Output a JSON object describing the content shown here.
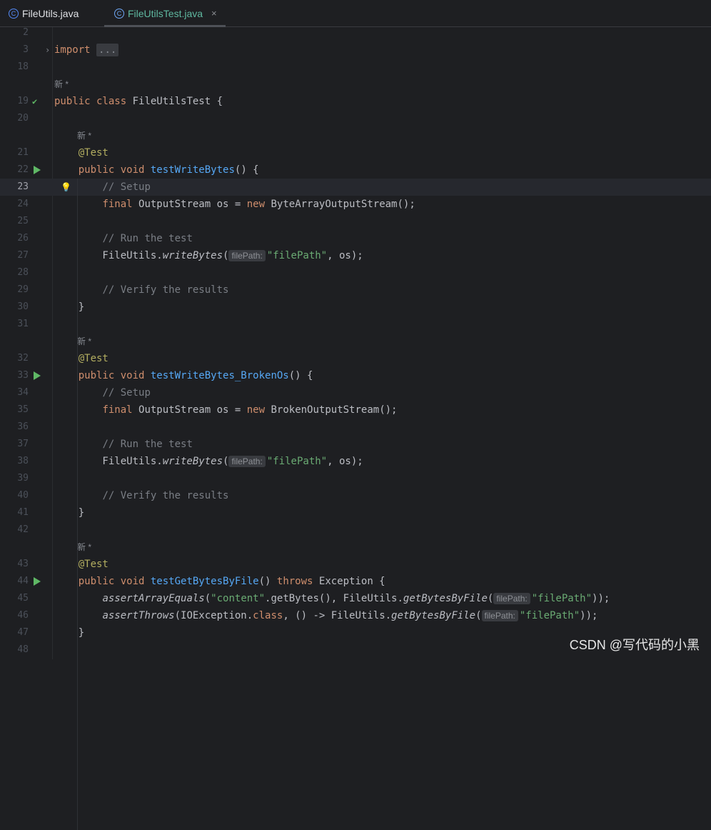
{
  "tabs": [
    {
      "label": "FileUtils.java",
      "icon": "class-icon"
    },
    {
      "label": "FileUtilsTest.java",
      "icon": "class-icon",
      "active": true,
      "close": "×"
    }
  ],
  "lines": [
    {
      "n": "2",
      "kind": "code",
      "html": ""
    },
    {
      "n": "3",
      "kind": "code",
      "fold": true,
      "html": "<span class='kw'>import</span> <span class='fold-box'>...</span>"
    },
    {
      "n": "18",
      "kind": "code",
      "html": ""
    },
    {
      "n": "",
      "kind": "hint",
      "indent": 0,
      "text": "新 *"
    },
    {
      "n": "19",
      "kind": "code",
      "icon": "check-run",
      "html": "<span class='kw'>public class</span> FileUtilsTest {"
    },
    {
      "n": "20",
      "kind": "code",
      "html": ""
    },
    {
      "n": "",
      "kind": "hint",
      "indent": 1,
      "text": "新 *"
    },
    {
      "n": "21",
      "kind": "code",
      "html": "    <span class='ann'>@Test</span>"
    },
    {
      "n": "22",
      "kind": "code",
      "icon": "run",
      "html": "    <span class='kw'>public void</span> <span class='fn'>testWriteBytes</span>() {"
    },
    {
      "n": "23",
      "kind": "code",
      "current": true,
      "bulb": true,
      "html": "        <span class='cm'>// Setup</span>"
    },
    {
      "n": "24",
      "kind": "code",
      "html": "        <span class='kw'>final</span> OutputStream os = <span class='kw'>new</span> ByteArrayOutputStream();"
    },
    {
      "n": "25",
      "kind": "code",
      "html": ""
    },
    {
      "n": "26",
      "kind": "code",
      "html": "        <span class='cm'>// Run the test</span>"
    },
    {
      "n": "27",
      "kind": "code",
      "html": "        FileUtils.<span class='it'>writeBytes</span>(<span class='inlay'>filePath:</span><span class='str'>\"filePath\"</span>, os);"
    },
    {
      "n": "28",
      "kind": "code",
      "html": ""
    },
    {
      "n": "29",
      "kind": "code",
      "html": "        <span class='cm'>// Verify the results</span>"
    },
    {
      "n": "30",
      "kind": "code",
      "html": "    }"
    },
    {
      "n": "31",
      "kind": "code",
      "html": ""
    },
    {
      "n": "",
      "kind": "hint",
      "indent": 1,
      "text": "新 *"
    },
    {
      "n": "32",
      "kind": "code",
      "html": "    <span class='ann'>@Test</span>"
    },
    {
      "n": "33",
      "kind": "code",
      "icon": "run",
      "html": "    <span class='kw'>public void</span> <span class='fn'>testWriteBytes_BrokenOs</span>() {"
    },
    {
      "n": "34",
      "kind": "code",
      "html": "        <span class='cm'>// Setup</span>"
    },
    {
      "n": "35",
      "kind": "code",
      "html": "        <span class='kw'>final</span> OutputStream os = <span class='kw'>new</span> BrokenOutputStream();"
    },
    {
      "n": "36",
      "kind": "code",
      "html": ""
    },
    {
      "n": "37",
      "kind": "code",
      "html": "        <span class='cm'>// Run the test</span>"
    },
    {
      "n": "38",
      "kind": "code",
      "html": "        FileUtils.<span class='it'>writeBytes</span>(<span class='inlay'>filePath:</span><span class='str'>\"filePath\"</span>, os);"
    },
    {
      "n": "39",
      "kind": "code",
      "html": ""
    },
    {
      "n": "40",
      "kind": "code",
      "html": "        <span class='cm'>// Verify the results</span>"
    },
    {
      "n": "41",
      "kind": "code",
      "html": "    }"
    },
    {
      "n": "42",
      "kind": "code",
      "html": ""
    },
    {
      "n": "",
      "kind": "hint",
      "indent": 1,
      "text": "新 *"
    },
    {
      "n": "43",
      "kind": "code",
      "html": "    <span class='ann'>@Test</span>"
    },
    {
      "n": "44",
      "kind": "code",
      "icon": "run",
      "html": "    <span class='kw'>public void</span> <span class='fn'>testGetBytesByFile</span>() <span class='kw'>throws</span> Exception {"
    },
    {
      "n": "45",
      "kind": "code",
      "html": "        <span class='it'>assertArrayEquals</span>(<span class='str'>\"content\"</span>.getBytes(), FileUtils.<span class='it'>getBytesByFile</span>(<span class='inlay'>filePath:</span><span class='str'>\"filePath\"</span>));"
    },
    {
      "n": "46",
      "kind": "code",
      "html": "        <span class='it'>assertThrows</span>(IOException.<span class='kw'>class</span>, () -> FileUtils.<span class='it'>getBytesByFile</span>(<span class='inlay'>filePath:</span><span class='str'>\"filePath\"</span>));"
    },
    {
      "n": "47",
      "kind": "code",
      "html": "    }"
    },
    {
      "n": "48",
      "kind": "code",
      "html": ""
    }
  ],
  "watermark": "CSDN @写代码的小黑"
}
